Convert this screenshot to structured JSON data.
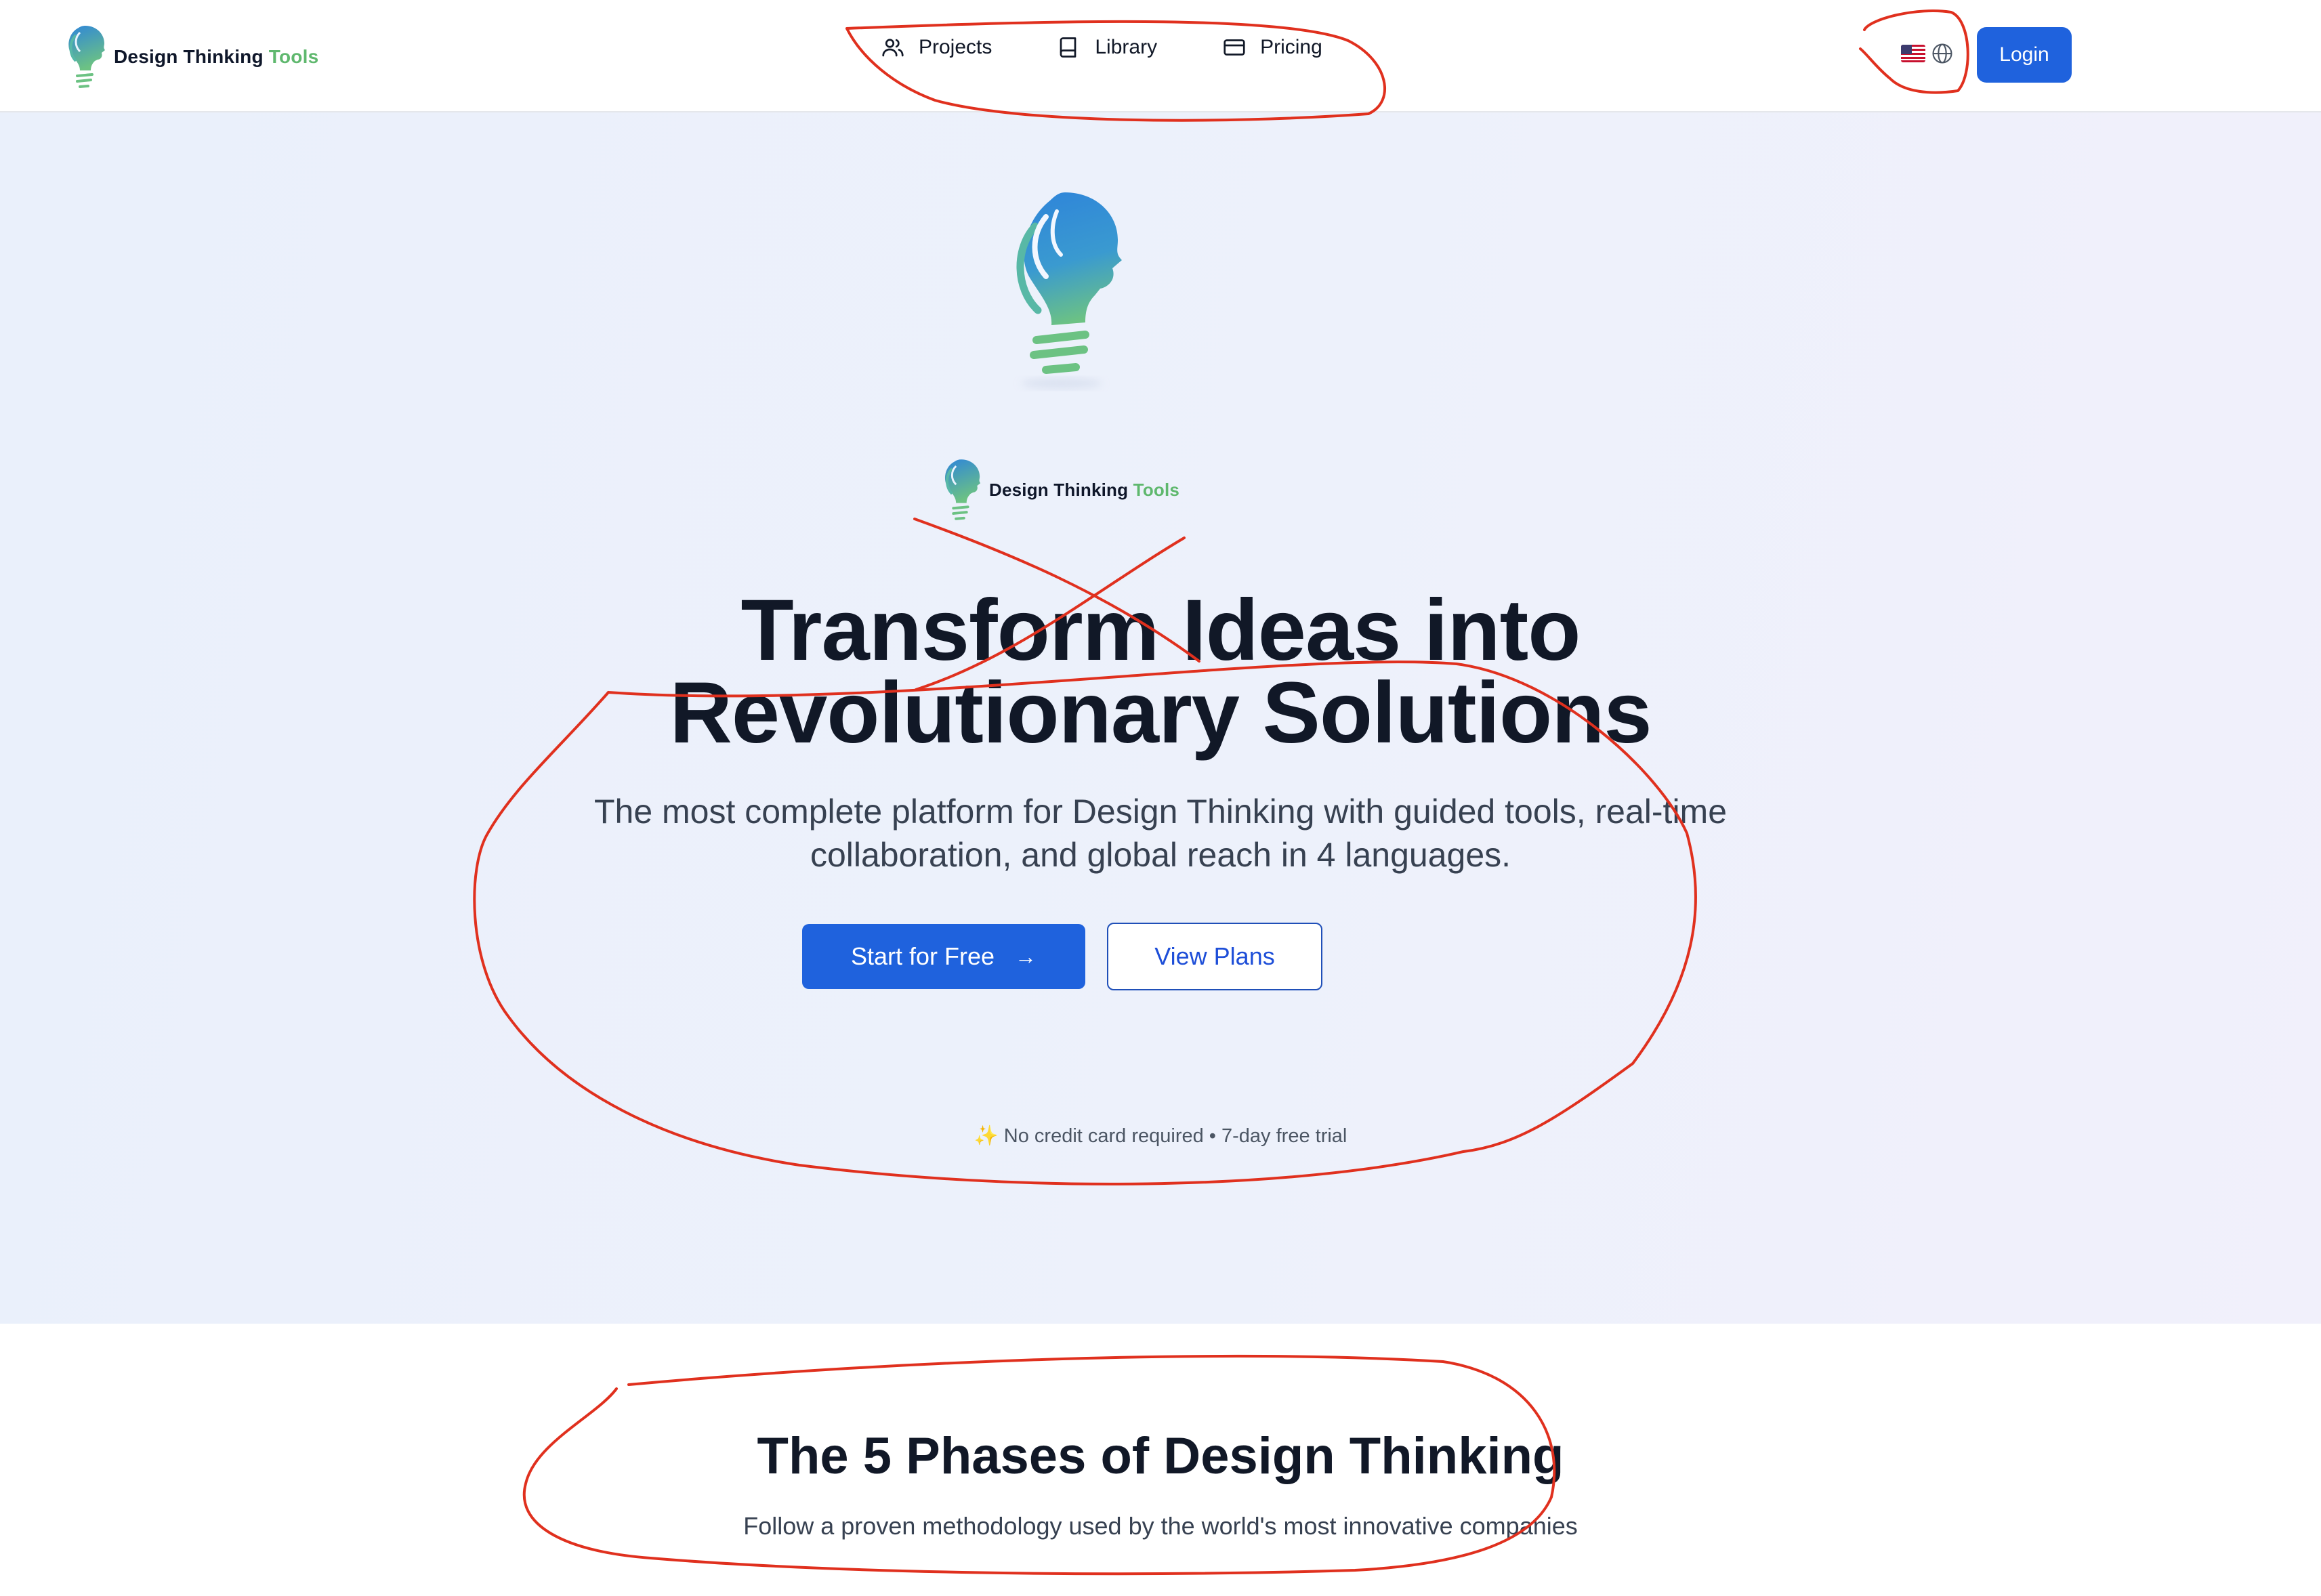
{
  "header": {
    "brand": {
      "name": "Design Thinking",
      "accent": "Tools"
    },
    "nav": [
      {
        "label": "Projects",
        "icon": "users-icon"
      },
      {
        "label": "Library",
        "icon": "book-icon"
      },
      {
        "label": "Pricing",
        "icon": "credit-card-icon"
      }
    ],
    "language": {
      "flag": "us-flag-icon",
      "icon": "globe-icon"
    },
    "login_label": "Login"
  },
  "hero": {
    "brand": {
      "name": "Design Thinking",
      "accent": "Tools"
    },
    "title_line1": "Transform Ideas into",
    "title_line2": "Revolutionary Solutions",
    "subtitle_line1": "The most complete platform for Design Thinking with guided tools, real-time",
    "subtitle_line2": "collaboration, and global reach in 4 languages.",
    "cta_primary": "Start for Free",
    "cta_secondary": "View Plans",
    "note_icon": "✨",
    "note": "No credit card required • 7-day free trial"
  },
  "phases": {
    "title": "The 5 Phases of Design Thinking",
    "subtitle": "Follow a proven methodology used by the world's most innovative companies"
  },
  "colors": {
    "primary": "#1f62dd",
    "brand_accent": "#5fb86e",
    "annotation": "#e0301e",
    "hero_bg": "#eaf0fb"
  }
}
